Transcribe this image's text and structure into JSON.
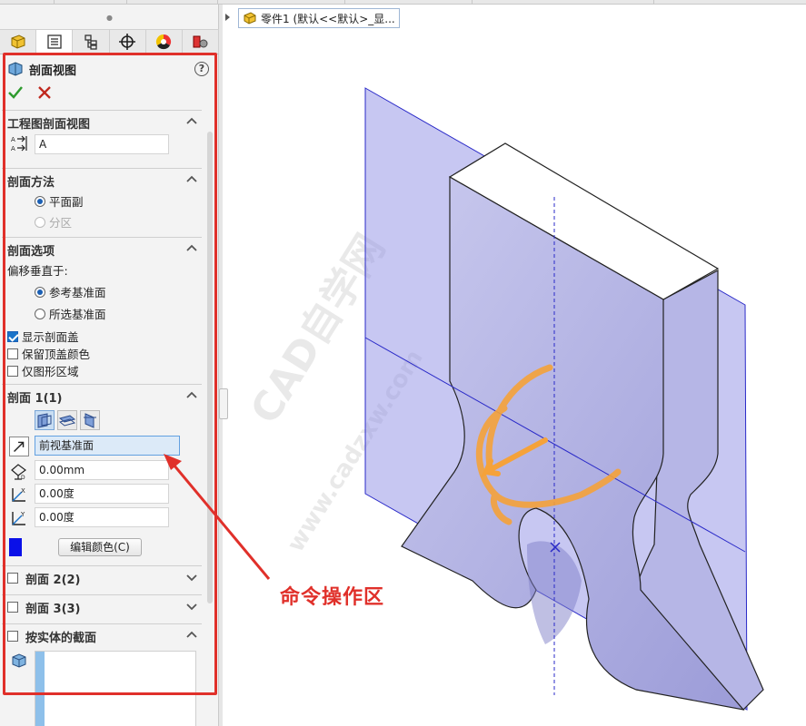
{
  "breadcrumb": {
    "part_label": "零件1 (默认<<默认>_显..."
  },
  "property_manager": {
    "title": "剖面视图",
    "help": "?",
    "tabs": [
      "feature-manager",
      "property-manager",
      "configuration-manager",
      "dimxpert",
      "display-manager",
      "appearance"
    ],
    "sections": {
      "drawing_section": {
        "title": "工程图剖面视图",
        "label_value": "A"
      },
      "method": {
        "title": "剖面方法",
        "options": [
          "平面副",
          "分区"
        ]
      },
      "options": {
        "title": "剖面选项",
        "offset_label": "偏移垂直于:",
        "radios": [
          "参考基准面",
          "所选基准面"
        ],
        "checks": [
          "显示剖面盖",
          "保留顶盖颜色",
          "仅图形区域"
        ]
      },
      "section1": {
        "title": "剖面 1(1)",
        "plane": "前视基准面",
        "offset": "0.00mm",
        "angle_x": "0.00度",
        "angle_y": "0.00度",
        "edit_color": "编辑颜色(C)",
        "color": "#0a10e8"
      },
      "section2": {
        "title": "剖面 2(2)"
      },
      "section3": {
        "title": "剖面 3(3)"
      },
      "by_body": {
        "title": "按实体的截面"
      }
    }
  },
  "annotation": {
    "text": "命令操作区"
  },
  "colors": {
    "highlight_frame": "#e0302a",
    "section_plane": "#8f8fe6",
    "rotation_handle": "#f5a23a"
  }
}
